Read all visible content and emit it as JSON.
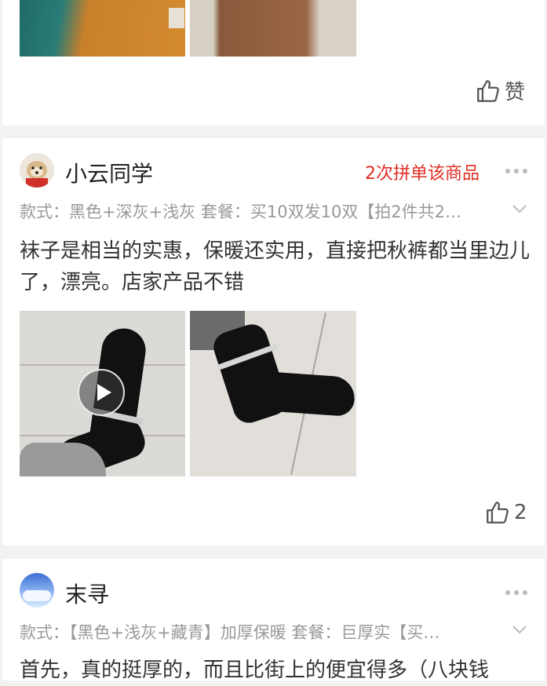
{
  "review_top": {
    "like_label": "赞"
  },
  "review_1": {
    "username": "小云同学",
    "badge": "2次拼单该商品",
    "spec": "款式：黑色+深灰+浅灰 套餐：买10双发10双【拍2件共2…",
    "text": "袜子是相当的实惠，保暖还实用，直接把秋裤都当里边儿了，漂亮。店家产品不错",
    "like_count": "2"
  },
  "review_2": {
    "username": "末寻",
    "spec": "款式：【黑色+浅灰+藏青】加厚保暖 套餐：巨厚实【买…",
    "text": "首先，真的挺厚的，而且比街上的便宜得多（八块钱"
  },
  "colors": {
    "badge": "#e02e24",
    "background": "#f2f2f2",
    "card": "#ffffff"
  },
  "icons": [
    "thumbs-up-icon",
    "more-dots-icon",
    "chevron-down-icon",
    "play-icon"
  ]
}
